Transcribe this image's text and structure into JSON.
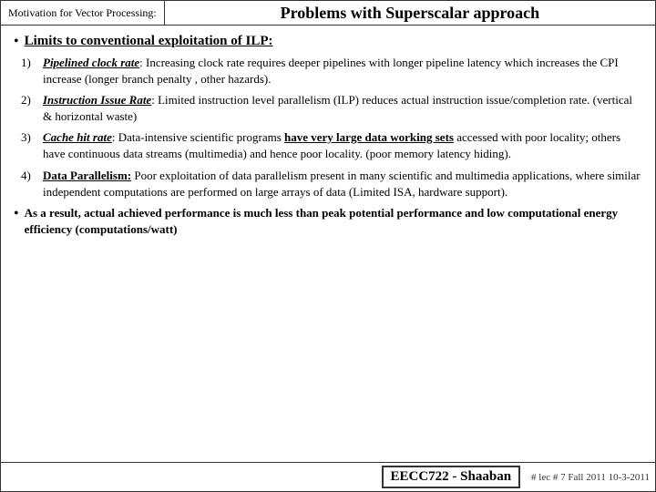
{
  "header": {
    "label": "Motivation for Vector Processing:",
    "title": "Problems with Superscalar approach"
  },
  "bullet1": {
    "text": "Limits to conventional exploitation of ILP:"
  },
  "items": [
    {
      "num": "1)",
      "term": "Pipelined clock rate",
      "colon": ":",
      "body": " Increasing clock rate requires deeper pipelines  with longer pipeline latency which increases the CPI increase (longer branch penalty , other hazards)."
    },
    {
      "num": "2)",
      "term": "Instruction Issue Rate",
      "colon": ":",
      "body": "  Limited instruction level parallelism (ILP) reduces actual instruction issue/completion rate. (vertical & horizontal waste)"
    },
    {
      "num": "3)",
      "term": "Cache hit rate",
      "colon": ":",
      "body": "  Data-intensive scientific programs ",
      "underline_part": "have very large data working sets",
      "body2": " accessed with poor locality;  others have continuous data streams (multimedia) and hence poor locality. (poor memory latency hiding)."
    },
    {
      "num": "4)",
      "term": "Data Parallelism:",
      "body": "  Poor exploitation of data parallelism present in many scientific and multimedia applications, where similar independent computations are performed on large arrays of data (Limited ISA, hardware support)."
    }
  ],
  "conclusion": {
    "bullet": "•",
    "text": "As a result, actual achieved performance is much less than peak potential performance and low computational energy efficiency (computations/watt)"
  },
  "footer": {
    "badge": "EECC722 - Shaaban",
    "ref": "# lec # 7   Fall 2011   10-3-2011"
  }
}
